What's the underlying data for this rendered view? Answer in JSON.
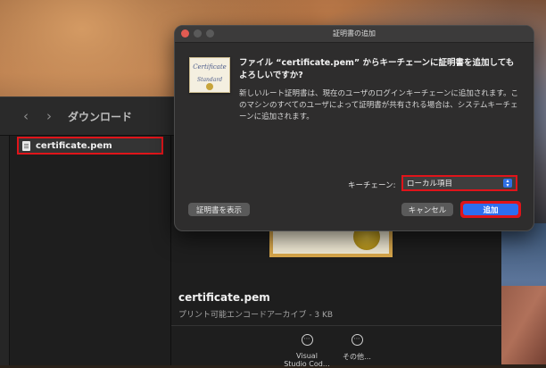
{
  "dialog": {
    "title": "証明書の追加",
    "heading": "ファイル “certificate.pem” からキーチェーンに証明書を追加してもよろしいですか?",
    "body": "新しいルート証明書は、現在のユーザのログインキーチェーンに追加されます。このマシンのすべてのユーザによって証明書が共有される場合は、システムキーチェーンに追加されます。",
    "cert_icon_line1": "Certificate",
    "cert_icon_line2": "Standard",
    "keychain_label": "キーチェーン:",
    "keychain_value": "ローカル項目",
    "show_cert_label": "証明書を表示",
    "cancel_label": "キャンセル",
    "add_label": "追加"
  },
  "finder": {
    "location": "ダウンロード",
    "file_name": "certificate.pem",
    "preview_name": "certificate.pem",
    "preview_meta": "プリント可能エンコードアーカイブ - 3 KB",
    "actions": [
      {
        "label": "Visual\nStudio Cod…"
      },
      {
        "label": "その他…"
      }
    ]
  },
  "icons": {
    "back": "‹",
    "forward": "›",
    "more": "⋯"
  },
  "colors": {
    "highlight": "#e0141a",
    "accent": "#2d6ef0"
  }
}
